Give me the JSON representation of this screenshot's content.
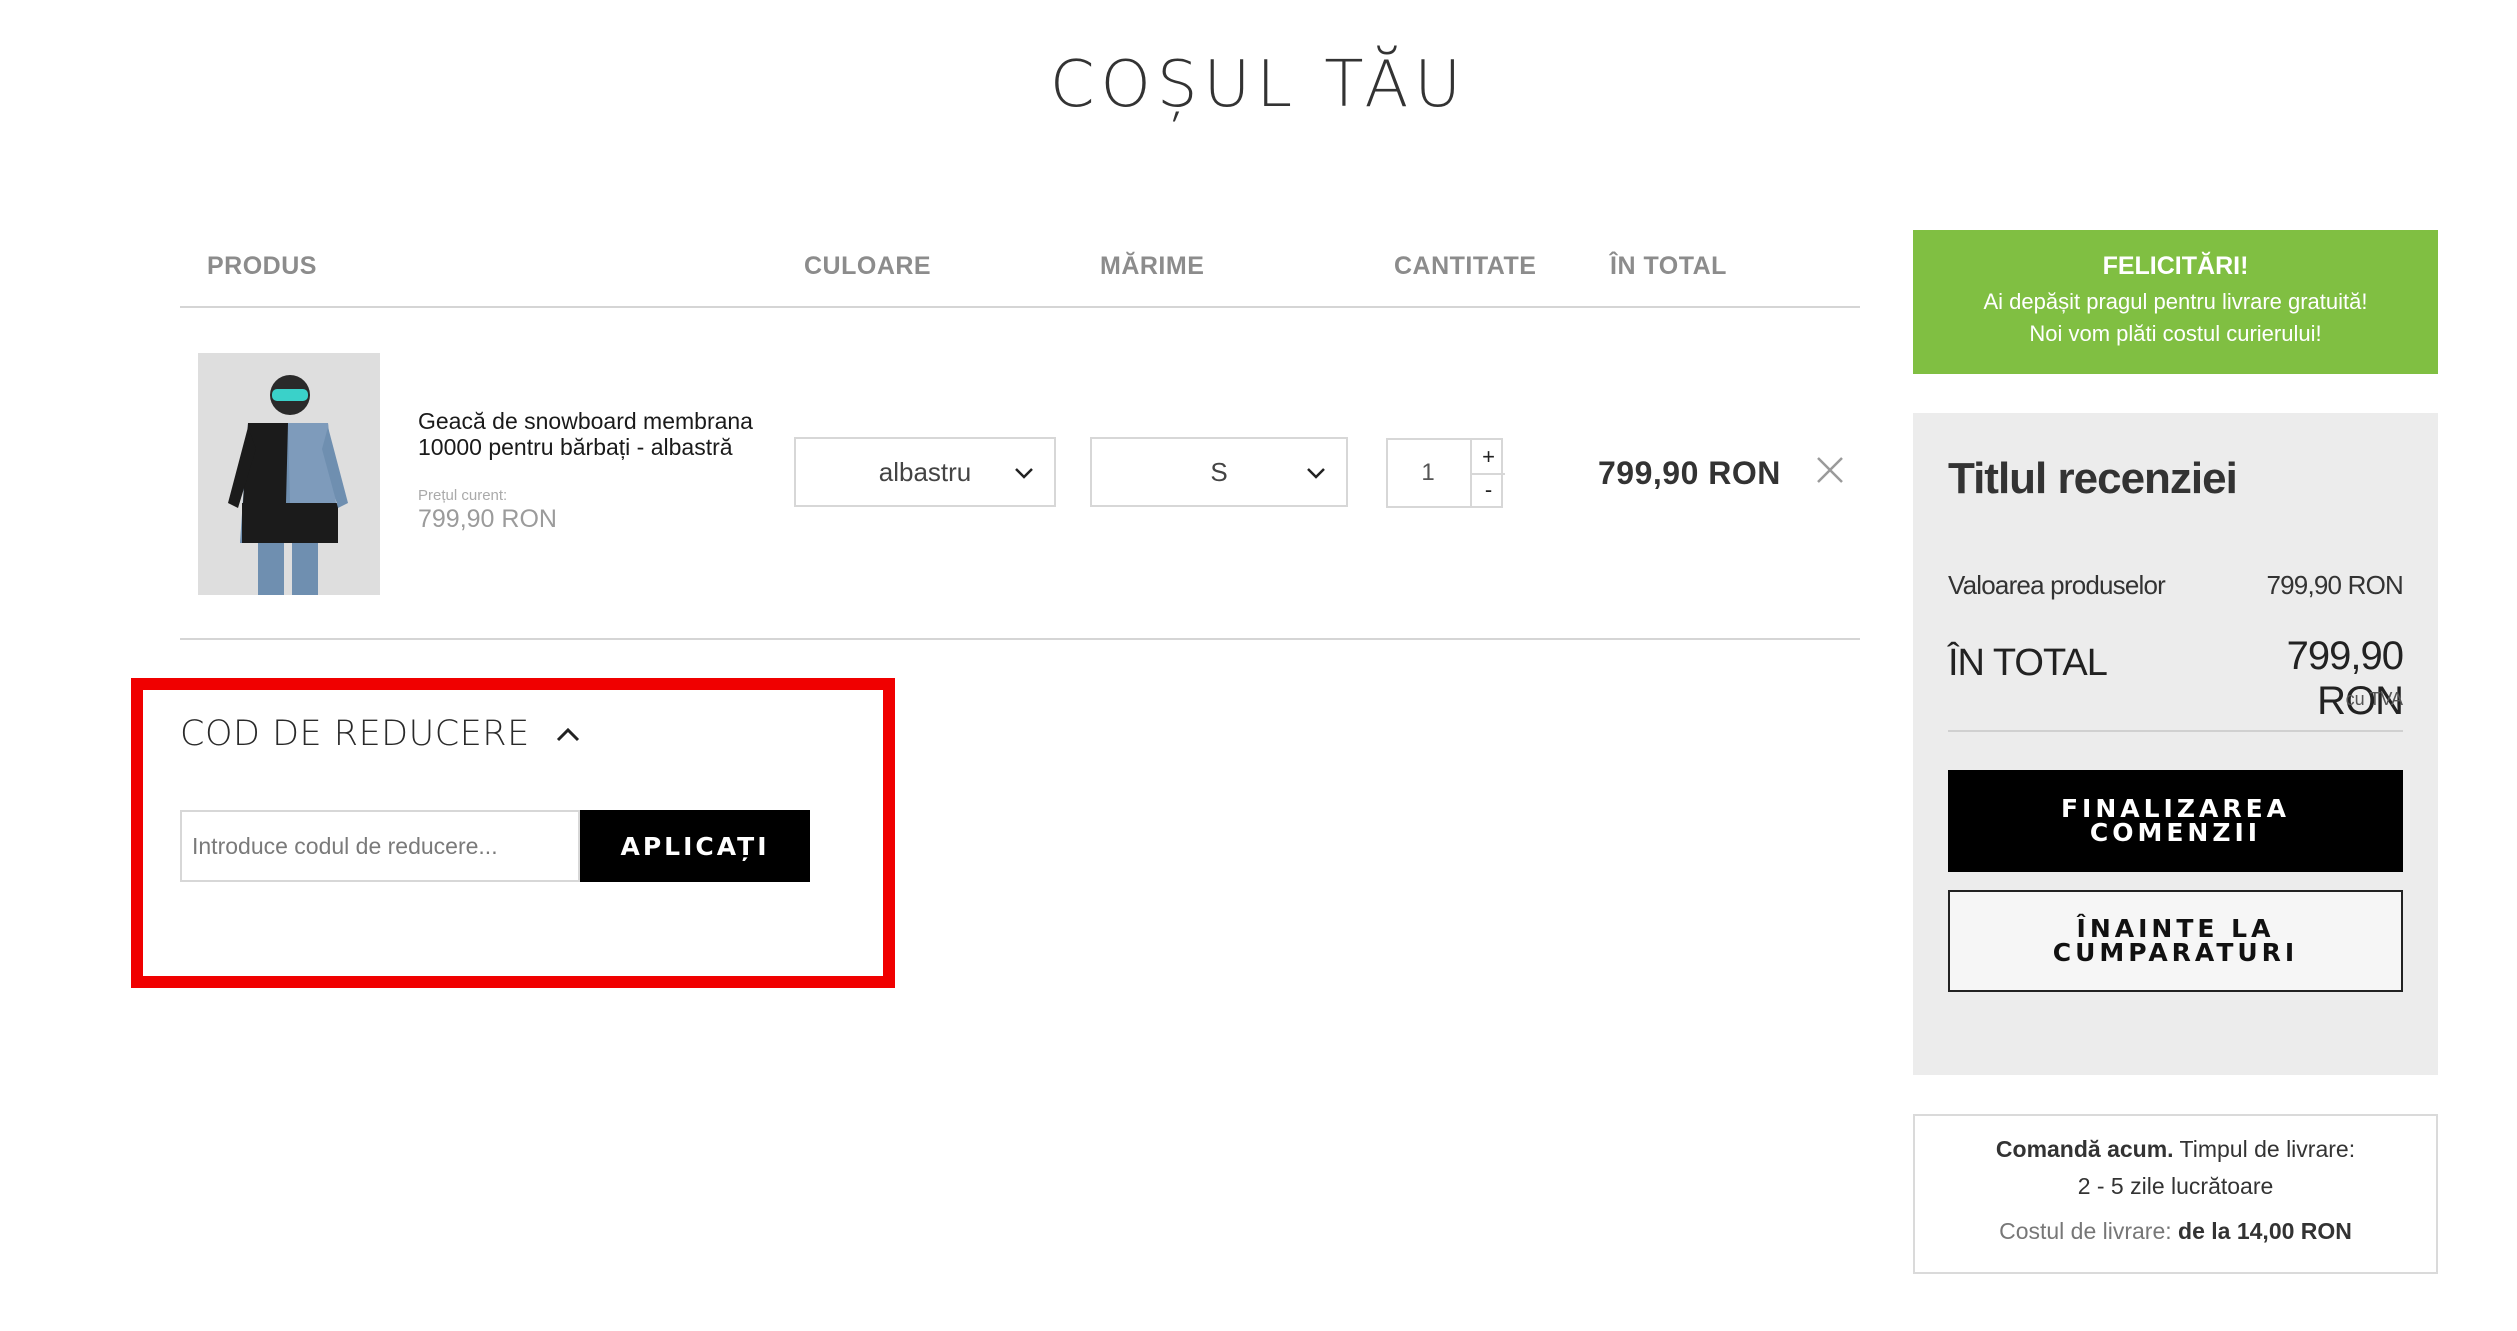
{
  "page": {
    "title": "COȘUL TĂU"
  },
  "cart_table": {
    "headers": {
      "product": "PRODUS",
      "color": "CULOARE",
      "size": "MĂRIME",
      "quantity": "CANTITATE",
      "total": "ÎN TOTAL"
    },
    "item": {
      "name": "Geacă de snowboard membrana 10000 pentru bărbați - albastră",
      "price_label": "Prețul curent:",
      "price": "799,90 RON",
      "color": "albastru",
      "size": "S",
      "quantity": "1",
      "qty_plus": "+",
      "qty_minus": "-",
      "total": "799,90 RON"
    }
  },
  "discount": {
    "title": "COD DE REDUCERE",
    "placeholder": "Introduce codul de reducere...",
    "apply_label": "APLICAȚI"
  },
  "free_shipping": {
    "title": "FELICITĂRI!",
    "line1": "Ai depășit pragul pentru livrare gratuită!",
    "line2": "Noi vom plăti costul curierului!"
  },
  "summary": {
    "title": "Titlul recenziei",
    "products_label": "Valoarea produselor",
    "products_value": "799,90 RON",
    "total_label": "ÎN TOTAL",
    "total_value": "799,90 RON",
    "vat_note": "cu TVA",
    "checkout_line1": "FINALIZAREA",
    "checkout_line2": "COMENZII",
    "continue_line1": "ÎNAINTE LA",
    "continue_line2": "CUMPARATURI"
  },
  "delivery": {
    "order_now": "Comandă acum.",
    "delivery_time_label": "Timpul de livrare:",
    "delivery_time": "2 - 5 zile lucrătoare",
    "cost_label": "Costul de livrare:",
    "cost_value": "de la 14,00 RON"
  },
  "colors": {
    "accent_green": "#80bf42",
    "highlight_red": "#f00000",
    "summary_bg": "#ececec"
  }
}
